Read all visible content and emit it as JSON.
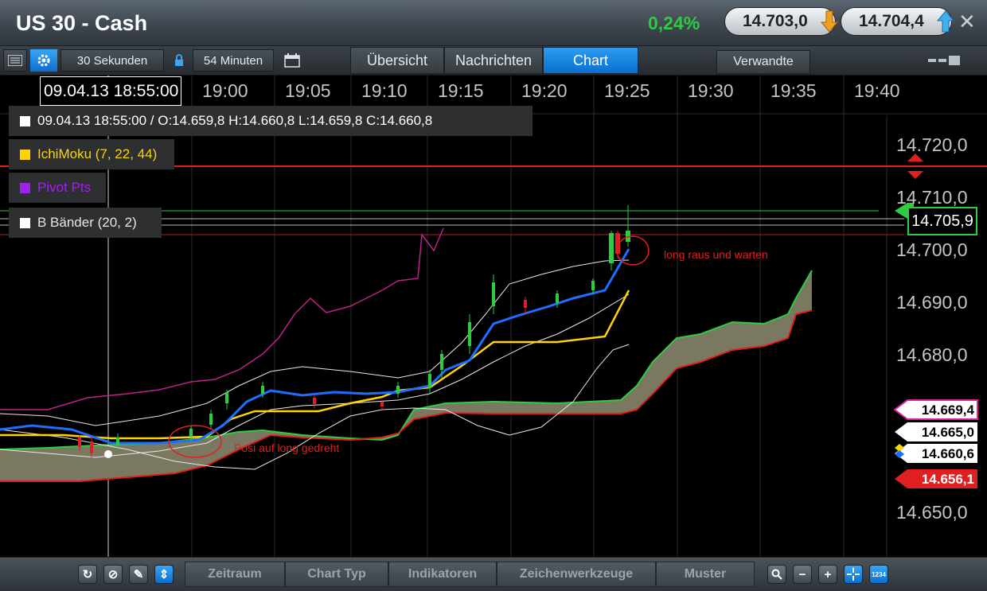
{
  "window": {
    "title": "US 30 - Cash",
    "change_pct": "0,24%",
    "bid": "14.703,0",
    "ask": "14.704,4"
  },
  "toolbar": {
    "interval": "30 Sekunden",
    "range": "54 Minuten",
    "tabs": [
      "Übersicht",
      "Nachrichten",
      "Chart"
    ],
    "related": "Verwandte"
  },
  "chart": {
    "cursor_time": "09.04.13 18:55:00",
    "time_labels": [
      "19:00",
      "19:05",
      "19:10",
      "19:15",
      "19:20",
      "19:25",
      "19:30",
      "19:35",
      "19:40"
    ],
    "price_labels": [
      "14.720,0",
      "14.710,0",
      "14.700,0",
      "14.690,0",
      "14.680,0",
      "14.650,0"
    ],
    "ohlc_text": "09.04.13 18:55:00 / O:14.659,8  H:14.660,8  L:14.659,8  C:14.660,8",
    "legend": [
      {
        "label": "IchiMoku (7, 22, 44)",
        "color": "#ffd400"
      },
      {
        "label": "Pivot Pts",
        "color": "#a020f0"
      },
      {
        "label": "B Bänder (20, 2)",
        "color": "#ffffff"
      }
    ],
    "current_price": "14.705,9",
    "price_tags": [
      {
        "value": "14.669,4",
        "color": "#ffffff"
      },
      {
        "value": "14.665,0",
        "color": "#ffffff"
      },
      {
        "value": "14.660,6",
        "color": "#ffffff"
      },
      {
        "value": "14.656,1",
        "color": "#e0201e"
      }
    ],
    "annotations": {
      "entry": "Posi auf long gedreht",
      "exit": "long raus und warten"
    }
  },
  "bottombar": {
    "tabs": [
      "Zeitraum",
      "Chart Typ",
      "Indikatoren",
      "Zeichenwerkzeuge",
      "Muster"
    ],
    "zoom_label": "1234"
  }
}
